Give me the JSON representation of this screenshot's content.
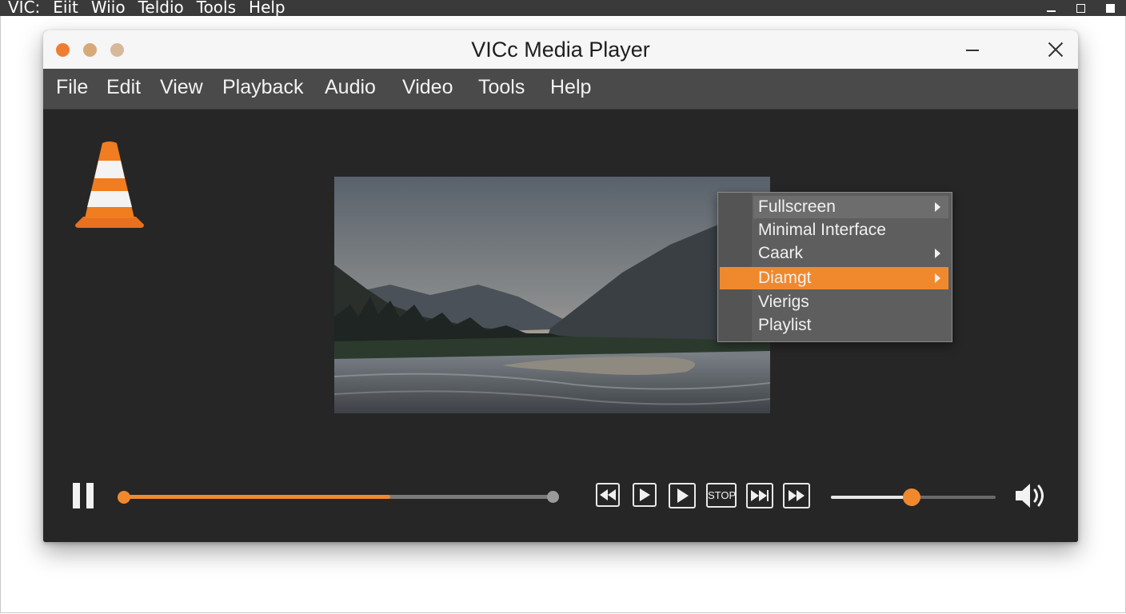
{
  "outer": {
    "menu": [
      "VIC:",
      "Eiit",
      "Wiio",
      "Teldio",
      "Tools",
      "Help"
    ]
  },
  "window": {
    "title": "VICc Media Player"
  },
  "menubar": {
    "items": [
      "File",
      "Edit",
      "View",
      "Playback",
      "Audio",
      "Video",
      "Tools",
      "Help"
    ]
  },
  "context_menu": {
    "items": [
      {
        "label": "Fullscreen",
        "submenu": true
      },
      {
        "label": "Minimal Interface",
        "submenu": false
      },
      {
        "label": "Caark",
        "submenu": true
      },
      {
        "label": "Diamgt",
        "submenu": true,
        "highlighted": true
      },
      {
        "label": "Vierigs",
        "submenu": false
      },
      {
        "label": "Playlist",
        "submenu": false
      }
    ]
  },
  "controls": {
    "stop_label": "STOP",
    "seek_progress": 0.62,
    "volume_level": 0.49
  },
  "colors": {
    "accent": "#f0892e",
    "window_bg": "#262626",
    "menubar_bg": "#4a4a4a"
  },
  "icons": [
    "vlc-cone-icon",
    "pause-icon",
    "rewind-icon",
    "play-icon",
    "stop-icon",
    "fast-forward-icon",
    "next-icon",
    "speaker-icon"
  ]
}
